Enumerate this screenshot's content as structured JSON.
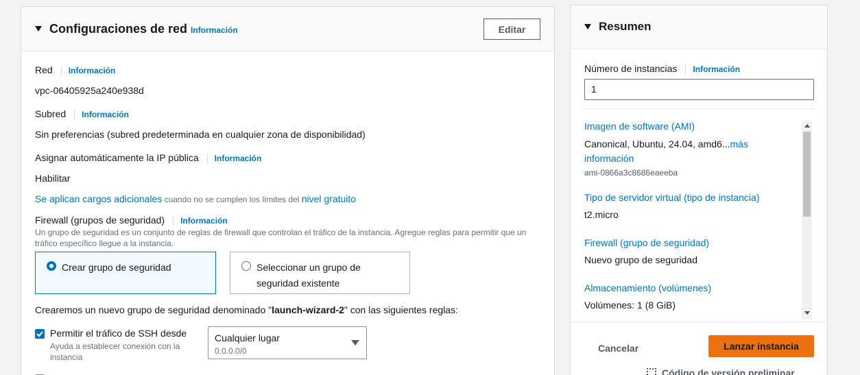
{
  "network": {
    "title": "Configuraciones de red",
    "info": "Información",
    "edit_label": "Editar",
    "network_label": "Red",
    "network_info": "Información",
    "vpc": "vpc-06405925a240e938d",
    "subnet_label": "Subred",
    "subnet_info": "Información",
    "subnet_value": "Sin preferencias (subred predeterminada en cualquier zona de disponibilidad)",
    "public_ip_label": "Asignar automáticamente la IP pública",
    "public_ip_info": "Información",
    "public_ip_value": "Habilitar",
    "charges_link": "Se aplican cargos adicionales",
    "charges_mid": " cuando no se cumplen los límites del ",
    "free_tier_link": "nivel gratuito",
    "firewall_label": "Firewall (grupos de seguridad)",
    "firewall_info": "Información",
    "firewall_desc_1": "Un grupo de seguridad es un conjunto de reglas de firewall que controlan el tráfico de la instancia. Agregue reglas para permitir que un",
    "firewall_desc_2": "tráfico específico llegue a la instancia.",
    "option_create": "Crear grupo de seguridad",
    "option_existing_1": "Seleccionar un grupo de",
    "option_existing_2": "seguridad existente",
    "rules_prefix": "Crearemos un nuevo grupo de seguridad denominado \"",
    "rules_name": "launch-wizard-2",
    "rules_suffix": "\" con las siguientes reglas:",
    "ssh_label": "Permitir el tráfico de SSH desde",
    "ssh_help_1": "Ayuda a establecer conexión con la",
    "ssh_help_2": "instancia",
    "ssh_checked": true,
    "source_value": "Cualquier lugar",
    "source_cidr": "0.0.0.0/0"
  },
  "summary": {
    "title": "Resumen",
    "instances_label": "Número de instancias",
    "instances_info": "Información",
    "instances_value": "1",
    "ami_label": "Imagen de software (AMI)",
    "ami_value": "Canonical, Ubuntu, 24.04, amd6...",
    "ami_more_1": "más",
    "ami_more_2": "información",
    "ami_id": "ami-0866a3c8686eaeeba",
    "type_label": "Tipo de servidor virtual (tipo de instancia)",
    "type_value": "t2.micro",
    "firewall_label": "Firewall (grupo de seguridad)",
    "firewall_value": "Nuevo grupo de seguridad",
    "storage_label": "Almacenamiento (volúmenes)",
    "storage_value": "Volúmenes: 1 (8 GiB)",
    "cancel_label": "Cancelar",
    "launch_label": "Lanzar instancia",
    "preview_label": "Código de versión preliminar"
  },
  "colors": {
    "accent": "#0073bb",
    "launch": "#ec7211"
  }
}
